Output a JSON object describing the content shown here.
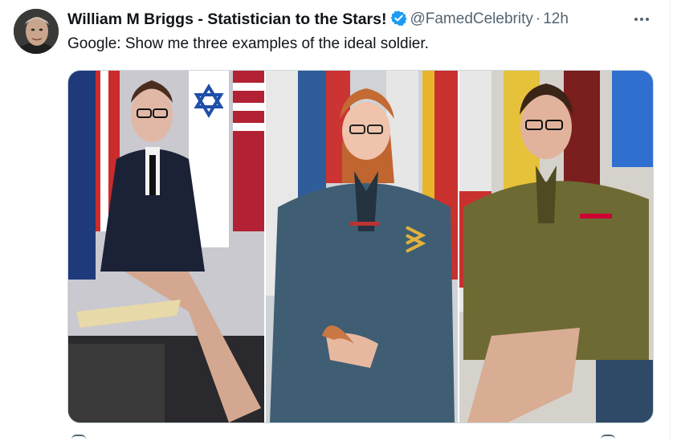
{
  "tweet": {
    "author_name": "William M Briggs - Statistician to the Stars!",
    "handle": "@FamedCelebrity",
    "separator": "·",
    "time": "12h",
    "text": "Google: Show me three examples of the ideal soldier.",
    "verified": true
  },
  "colors": {
    "verified_badge": "#1d9bf0",
    "secondary_text": "#536471",
    "primary_text": "#0f1419"
  },
  "icons": [
    "verified-badge-icon",
    "more-options-icon"
  ],
  "media": {
    "image_count": 3
  }
}
